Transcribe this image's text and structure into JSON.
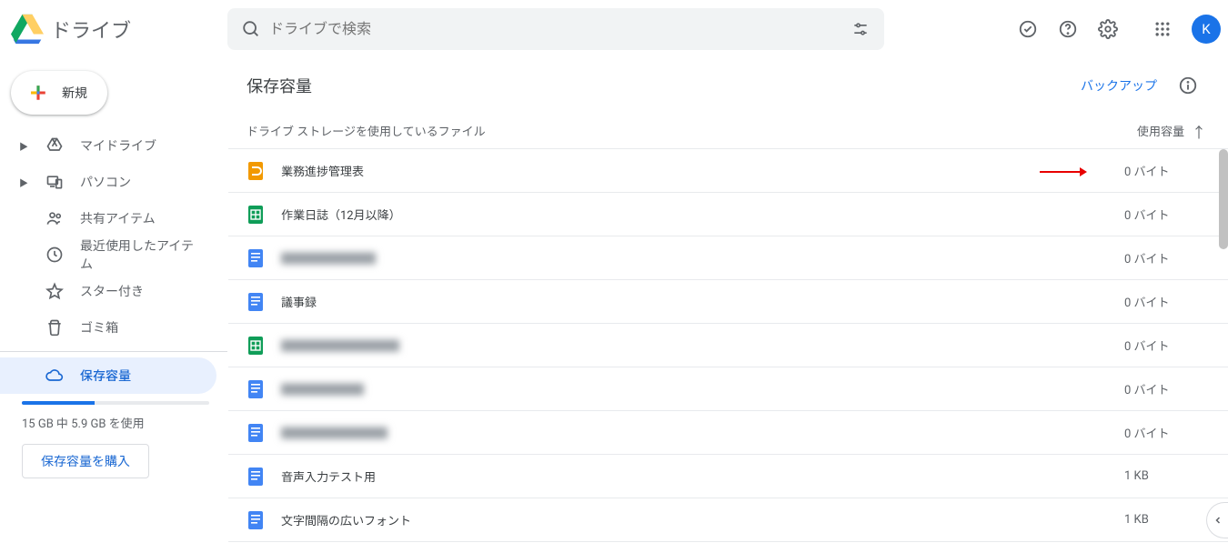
{
  "header": {
    "product_name": "ドライブ",
    "search_placeholder": "ドライブで検索",
    "avatar_initial": "K"
  },
  "sidebar": {
    "new_label": "新規",
    "items": [
      {
        "label": "マイドライブ",
        "expandable": true,
        "icon": "drive"
      },
      {
        "label": "パソコン",
        "expandable": true,
        "icon": "devices"
      },
      {
        "label": "共有アイテム",
        "expandable": false,
        "icon": "people"
      },
      {
        "label": "最近使用したアイテム",
        "expandable": false,
        "icon": "clock"
      },
      {
        "label": "スター付き",
        "expandable": false,
        "icon": "star"
      },
      {
        "label": "ゴミ箱",
        "expandable": false,
        "icon": "trash"
      }
    ],
    "storage_item_label": "保存容量",
    "storage_text": "15 GB 中 5.9 GB を使用",
    "buy_label": "保存容量を購入",
    "storage_used_pct": 39
  },
  "main": {
    "title": "保存容量",
    "backup_label": "バックアップ",
    "list_header_name": "ドライブ   ストレージを使用しているファイル",
    "list_header_size": "使用容量",
    "files": [
      {
        "name": "業務進捗管理表",
        "size": "0 バイト",
        "icon": "jamboard",
        "blurred": false
      },
      {
        "name": "作業日誌（12月以降）",
        "size": "0 バイト",
        "icon": "sheets",
        "blurred": false
      },
      {
        "name": "████████",
        "size": "0 バイト",
        "icon": "docs",
        "blurred": true
      },
      {
        "name": "議事録",
        "size": "0 バイト",
        "icon": "docs",
        "blurred": false
      },
      {
        "name": "██████████",
        "size": "0 バイト",
        "icon": "sheets",
        "blurred": true
      },
      {
        "name": "███████",
        "size": "0 バイト",
        "icon": "docs",
        "blurred": true
      },
      {
        "name": "█████████",
        "size": "0 バイト",
        "icon": "docs",
        "blurred": true
      },
      {
        "name": "音声入力テスト用",
        "size": "1 KB",
        "icon": "docs",
        "blurred": false
      },
      {
        "name": "文字間隔の広いフォント",
        "size": "1 KB",
        "icon": "docs",
        "blurred": false
      }
    ]
  }
}
